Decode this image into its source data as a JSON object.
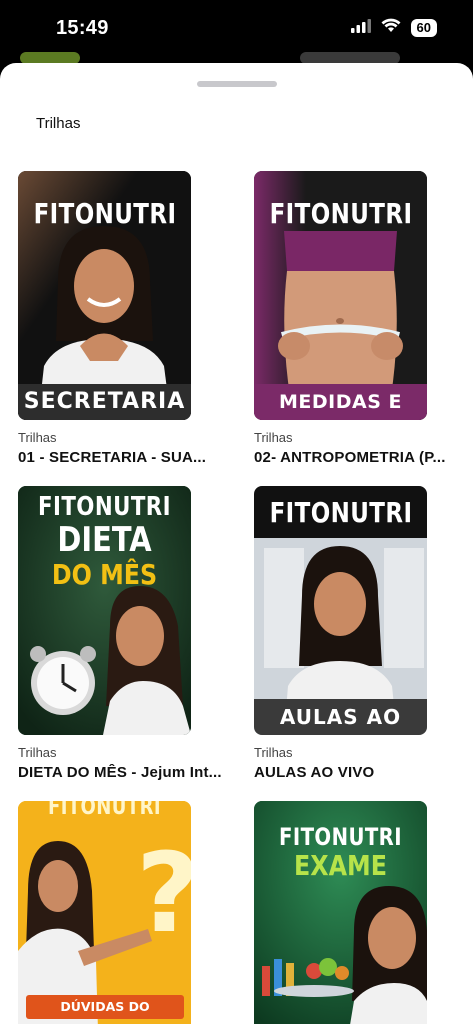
{
  "status": {
    "time": "15:49",
    "battery": "60"
  },
  "sheet": {
    "title": "Trilhas"
  },
  "cards": [
    {
      "category": "Trilhas",
      "name": "01 -  SECRETARIA - SUA...",
      "thumb_title": "FITONUTRI",
      "thumb_label": "SECRETARIA"
    },
    {
      "category": "Trilhas",
      "name": "02- ANTROPOMETRIA (P...",
      "thumb_title": "FITONUTRI",
      "thumb_label": "MEDIDAS E PESO"
    },
    {
      "category": "Trilhas",
      "name": "DIETA DO MÊS - Jejum Int...",
      "thumb_title": "FITONUTRI",
      "thumb_line2": "DIETA",
      "thumb_line3": "DO MÊS"
    },
    {
      "category": "Trilhas",
      "name": "AULAS AO VIVO",
      "thumb_title": "FITONUTRI",
      "thumb_label": "AULAS AO VIVO"
    },
    {
      "thumb_title": "FITONUTRI",
      "thumb_label": "DÚVIDAS DO PROGRAMA"
    },
    {
      "thumb_title": "FITONUTRI",
      "thumb_line2": "EXAME"
    }
  ],
  "colors": {
    "sheet_bg": "#ffffff",
    "grabber": "#c8c8cc",
    "card1_bg": "#111111",
    "card2_bg": "#1a1a1a",
    "card2_accent": "#7b2a68",
    "card3_bg": "#1f3d2a",
    "card3_accent": "#f2c014",
    "card4_bg": "#d9dde2",
    "card5_bg": "#f4b21b",
    "card5_label": "#e0541b",
    "card6_bg": "#1e6b3f",
    "card6_accent": "#b7e34a"
  }
}
